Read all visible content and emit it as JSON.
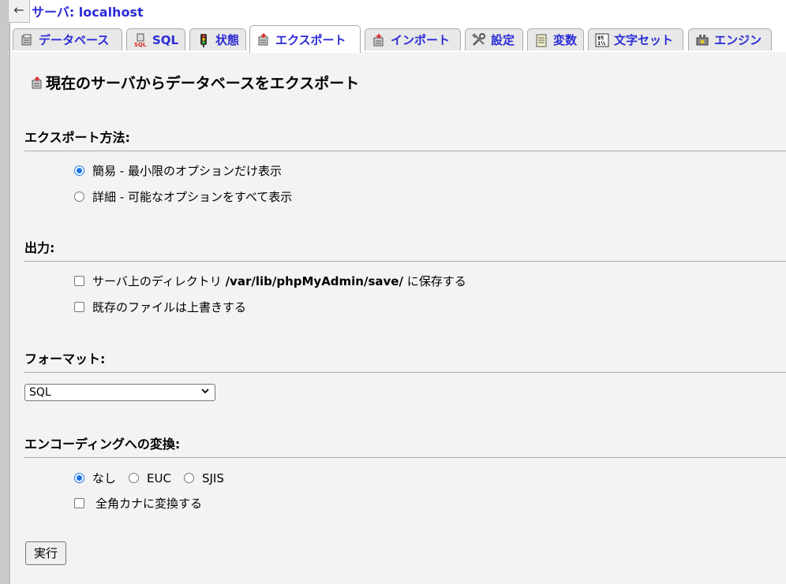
{
  "nav": {
    "back_glyph": "←",
    "server_link": "サーバ: localhost"
  },
  "tabs": [
    {
      "label": "データベース",
      "icon": "database-icon"
    },
    {
      "label": "SQL",
      "icon": "sql-icon"
    },
    {
      "label": "状態",
      "icon": "status-icon"
    },
    {
      "label": "エクスポート",
      "icon": "export-icon",
      "active": true
    },
    {
      "label": "インポート",
      "icon": "import-icon"
    },
    {
      "label": "設定",
      "icon": "settings-icon"
    },
    {
      "label": "変数",
      "icon": "variables-icon"
    },
    {
      "label": "文字セット",
      "icon": "charset-icon"
    },
    {
      "label": "エンジン",
      "icon": "engine-icon"
    }
  ],
  "page": {
    "title": "現在のサーバからデータベースをエクスポート"
  },
  "export_method": {
    "heading": "エクスポート方法:",
    "options": [
      {
        "label": "簡易 - 最小限のオプションだけ表示",
        "checked": true
      },
      {
        "label": "詳細 - 可能なオプションをすべて表示",
        "checked": false
      }
    ]
  },
  "output": {
    "heading": "出力:",
    "save_prefix": "サーバ上のディレクトリ ",
    "save_path": "/var/lib/phpMyAdmin/save/",
    "save_suffix": " に保存する",
    "overwrite_label": "既存のファイルは上書きする"
  },
  "format": {
    "heading": "フォーマット:",
    "selected": "SQL"
  },
  "encoding": {
    "heading": "エンコーディングへの変換:",
    "options": [
      {
        "label": "なし",
        "checked": true
      },
      {
        "label": "EUC",
        "checked": false
      },
      {
        "label": "SJIS",
        "checked": false
      }
    ],
    "kana_label": "全角カナに変換する"
  },
  "submit": {
    "label": "実行"
  },
  "colors": {
    "link": "#2b2bd6",
    "panel_bg": "#f3f3f3",
    "radio_checked": "#1a73e8"
  }
}
